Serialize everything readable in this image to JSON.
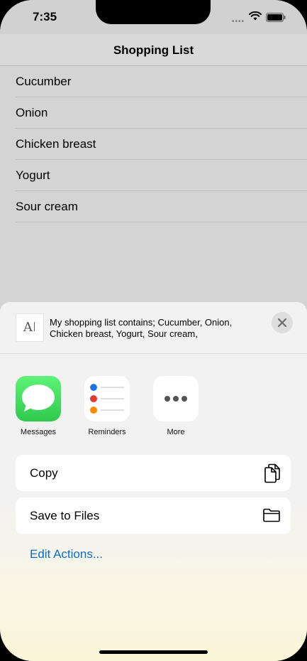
{
  "status_bar": {
    "time": "7:35"
  },
  "nav": {
    "title": "Shopping List"
  },
  "list": {
    "items": [
      {
        "label": "Cucumber"
      },
      {
        "label": "Onion"
      },
      {
        "label": "Chicken breast"
      },
      {
        "label": "Yogurt"
      },
      {
        "label": "Sour cream"
      }
    ]
  },
  "share_sheet": {
    "preview_text": "My shopping list contains; Cucumber, Onion, Chicken breast, Yogurt, Sour cream,",
    "apps": [
      {
        "label": "Messages",
        "icon": "messages-icon"
      },
      {
        "label": "Reminders",
        "icon": "reminders-icon"
      },
      {
        "label": "More",
        "icon": "more-icon"
      }
    ],
    "actions": [
      {
        "label": "Copy",
        "icon": "copy-icon"
      },
      {
        "label": "Save to Files",
        "icon": "folder-icon"
      }
    ],
    "edit_actions_label": "Edit Actions..."
  },
  "colors": {
    "link": "#0a6ecb",
    "messages_green": "#34c759",
    "reminder_dots": [
      "#1a73e8",
      "#e53935",
      "#fb8c00"
    ]
  }
}
